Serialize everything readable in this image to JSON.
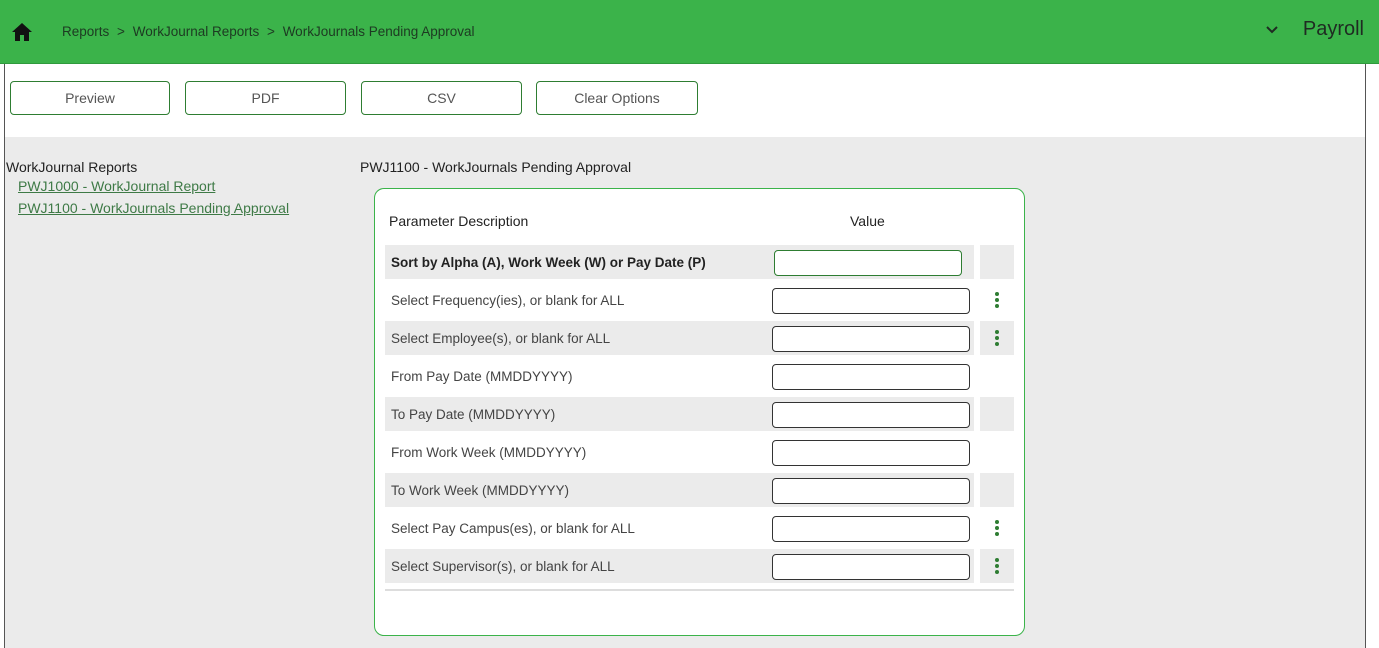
{
  "header": {
    "breadcrumb": [
      "Reports",
      "WorkJournal Reports",
      "WorkJournals Pending Approval"
    ],
    "separator": ">",
    "module": "Payroll",
    "accent_color": "#3bb34a"
  },
  "toolbar": {
    "preview_label": "Preview",
    "pdf_label": "PDF",
    "csv_label": "CSV",
    "clear_label": "Clear Options"
  },
  "sidebar": {
    "title": "WorkJournal Reports",
    "items": [
      {
        "label": "PWJ1000 - WorkJournal Report"
      },
      {
        "label": "PWJ1100 - WorkJournals Pending Approval"
      }
    ]
  },
  "report": {
    "title": "PWJ1100 - WorkJournals Pending Approval",
    "col_description": "Parameter Description",
    "col_value": "Value",
    "params": [
      {
        "label": "Sort by Alpha (A), Work Week (W) or Pay Date (P)",
        "value": "",
        "has_lookup": false
      },
      {
        "label": "Select Frequency(ies), or blank for ALL",
        "value": "",
        "has_lookup": true
      },
      {
        "label": "Select Employee(s), or blank for ALL",
        "value": "",
        "has_lookup": true
      },
      {
        "label": "From Pay Date (MMDDYYYY)",
        "value": "",
        "has_lookup": false
      },
      {
        "label": "To Pay Date (MMDDYYYY)",
        "value": "",
        "has_lookup": false
      },
      {
        "label": "From Work Week (MMDDYYYY)",
        "value": "",
        "has_lookup": false
      },
      {
        "label": "To Work Week (MMDDYYYY)",
        "value": "",
        "has_lookup": false
      },
      {
        "label": "Select Pay Campus(es), or blank for ALL",
        "value": "",
        "has_lookup": true
      },
      {
        "label": "Select Supervisor(s), or blank for ALL",
        "value": "",
        "has_lookup": true
      }
    ]
  }
}
